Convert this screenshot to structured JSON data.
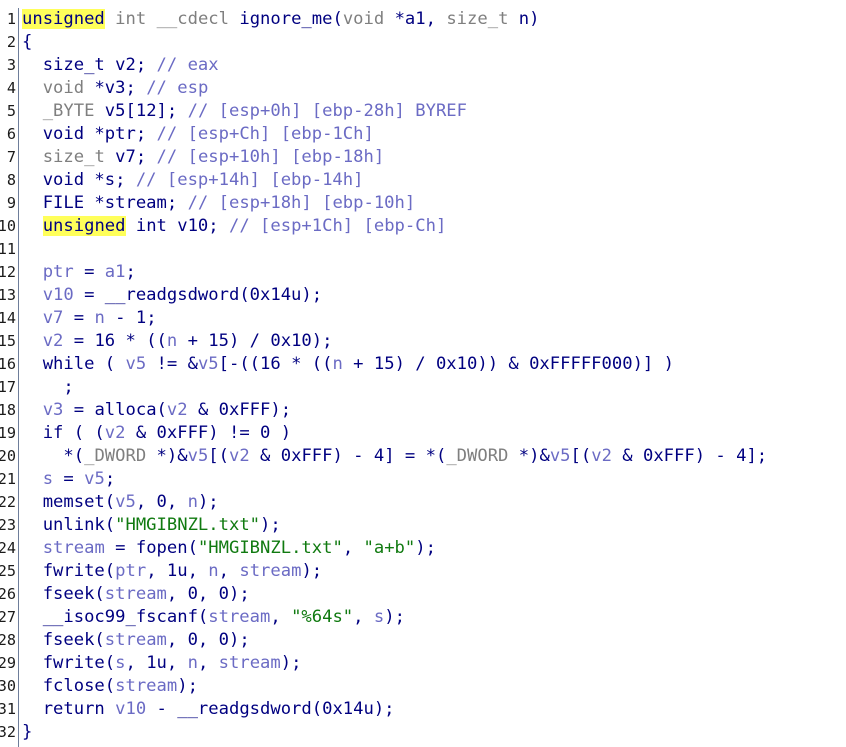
{
  "gutter": [
    "1",
    "2",
    "3",
    "4",
    "5",
    "6",
    "7",
    "8",
    "9",
    "10",
    "11",
    "12",
    "13",
    "14",
    "15",
    "16",
    "17",
    "18",
    "19",
    "20",
    "21",
    "22",
    "23",
    "24",
    "25",
    "26",
    "27",
    "28",
    "29",
    "30",
    "31",
    "32"
  ],
  "lines": [
    [
      [
        "hl",
        "unsigned"
      ],
      [
        "plain",
        " "
      ],
      [
        "type",
        "int"
      ],
      [
        "plain",
        " "
      ],
      [
        "type",
        "__cdecl"
      ],
      [
        "plain",
        " ignore_me("
      ],
      [
        "type",
        "void"
      ],
      [
        "plain",
        " *a1, "
      ],
      [
        "type",
        "size_t"
      ],
      [
        "plain",
        " n)"
      ]
    ],
    [
      [
        "plain",
        "{"
      ]
    ],
    [
      [
        "plain",
        "  size_t v2; "
      ],
      [
        "cmt",
        "// eax"
      ]
    ],
    [
      [
        "plain",
        "  "
      ],
      [
        "type",
        "void"
      ],
      [
        "plain",
        " *v3; "
      ],
      [
        "cmt",
        "// esp"
      ]
    ],
    [
      [
        "plain",
        "  "
      ],
      [
        "type",
        "_BYTE"
      ],
      [
        "plain",
        " v5[12]; "
      ],
      [
        "cmt",
        "// [esp+0h] [ebp-28h] BYREF"
      ]
    ],
    [
      [
        "plain",
        "  void *ptr; "
      ],
      [
        "cmt",
        "// [esp+Ch] [ebp-1Ch]"
      ]
    ],
    [
      [
        "plain",
        "  "
      ],
      [
        "type",
        "size_t"
      ],
      [
        "plain",
        " v7; "
      ],
      [
        "cmt",
        "// [esp+10h] [ebp-18h]"
      ]
    ],
    [
      [
        "plain",
        "  void *s; "
      ],
      [
        "cmt",
        "// [esp+14h] [ebp-14h]"
      ]
    ],
    [
      [
        "plain",
        "  FILE *stream; "
      ],
      [
        "cmt",
        "// [esp+18h] [ebp-10h]"
      ]
    ],
    [
      [
        "plain",
        "  "
      ],
      [
        "hl",
        "unsigned"
      ],
      [
        "plain",
        " int v10; "
      ],
      [
        "cmt",
        "// [esp+1Ch] [ebp-Ch]"
      ]
    ],
    [
      [
        "plain",
        ""
      ]
    ],
    [
      [
        "plain",
        "  "
      ],
      [
        "var",
        "ptr"
      ],
      [
        "plain",
        " = "
      ],
      [
        "var",
        "a1"
      ],
      [
        "plain",
        ";"
      ]
    ],
    [
      [
        "plain",
        "  "
      ],
      [
        "var",
        "v10"
      ],
      [
        "plain",
        " = __readgsdword(0x14u);"
      ]
    ],
    [
      [
        "plain",
        "  "
      ],
      [
        "var",
        "v7"
      ],
      [
        "plain",
        " = "
      ],
      [
        "var",
        "n"
      ],
      [
        "plain",
        " - 1;"
      ]
    ],
    [
      [
        "plain",
        "  "
      ],
      [
        "var",
        "v2"
      ],
      [
        "plain",
        " = 16 * (("
      ],
      [
        "var",
        "n"
      ],
      [
        "plain",
        " + 15) / 0x10);"
      ]
    ],
    [
      [
        "plain",
        "  while ( "
      ],
      [
        "var",
        "v5"
      ],
      [
        "plain",
        " != &"
      ],
      [
        "var",
        "v5"
      ],
      [
        "plain",
        "[-((16 * (("
      ],
      [
        "var",
        "n"
      ],
      [
        "plain",
        " + 15) / 0x10)) & 0xFFFFF000)] )"
      ]
    ],
    [
      [
        "plain",
        "    ;"
      ]
    ],
    [
      [
        "plain",
        "  "
      ],
      [
        "var",
        "v3"
      ],
      [
        "plain",
        " = alloca("
      ],
      [
        "var",
        "v2"
      ],
      [
        "plain",
        " & 0xFFF);"
      ]
    ],
    [
      [
        "plain",
        "  if ( ("
      ],
      [
        "var",
        "v2"
      ],
      [
        "plain",
        " & 0xFFF) != 0 )"
      ]
    ],
    [
      [
        "plain",
        "    *("
      ],
      [
        "type",
        "_DWORD"
      ],
      [
        "plain",
        " *)&"
      ],
      [
        "var",
        "v5"
      ],
      [
        "plain",
        "[("
      ],
      [
        "var",
        "v2"
      ],
      [
        "plain",
        " & 0xFFF) - 4] = *("
      ],
      [
        "type",
        "_DWORD"
      ],
      [
        "plain",
        " *)&"
      ],
      [
        "var",
        "v5"
      ],
      [
        "plain",
        "[("
      ],
      [
        "var",
        "v2"
      ],
      [
        "plain",
        " & 0xFFF) - 4];"
      ]
    ],
    [
      [
        "plain",
        "  "
      ],
      [
        "var",
        "s"
      ],
      [
        "plain",
        " = "
      ],
      [
        "var",
        "v5"
      ],
      [
        "plain",
        ";"
      ]
    ],
    [
      [
        "plain",
        "  memset("
      ],
      [
        "var",
        "v5"
      ],
      [
        "plain",
        ", 0, "
      ],
      [
        "var",
        "n"
      ],
      [
        "plain",
        ");"
      ]
    ],
    [
      [
        "plain",
        "  unlink("
      ],
      [
        "str",
        "\"HMGIBNZL.txt\""
      ],
      [
        "plain",
        ");"
      ]
    ],
    [
      [
        "plain",
        "  "
      ],
      [
        "var",
        "stream"
      ],
      [
        "plain",
        " = fopen("
      ],
      [
        "str",
        "\"HMGIBNZL.txt\""
      ],
      [
        "plain",
        ", "
      ],
      [
        "str",
        "\"a+b\""
      ],
      [
        "plain",
        ");"
      ]
    ],
    [
      [
        "plain",
        "  fwrite("
      ],
      [
        "var",
        "ptr"
      ],
      [
        "plain",
        ", 1u, "
      ],
      [
        "var",
        "n"
      ],
      [
        "plain",
        ", "
      ],
      [
        "var",
        "stream"
      ],
      [
        "plain",
        ");"
      ]
    ],
    [
      [
        "plain",
        "  fseek("
      ],
      [
        "var",
        "stream"
      ],
      [
        "plain",
        ", 0, 0);"
      ]
    ],
    [
      [
        "plain",
        "  __isoc99_fscanf("
      ],
      [
        "var",
        "stream"
      ],
      [
        "plain",
        ", "
      ],
      [
        "str",
        "\"%64s\""
      ],
      [
        "plain",
        ", "
      ],
      [
        "var",
        "s"
      ],
      [
        "plain",
        ");"
      ]
    ],
    [
      [
        "plain",
        "  fseek("
      ],
      [
        "var",
        "stream"
      ],
      [
        "plain",
        ", 0, 0);"
      ]
    ],
    [
      [
        "plain",
        "  fwrite("
      ],
      [
        "var",
        "s"
      ],
      [
        "plain",
        ", 1u, "
      ],
      [
        "var",
        "n"
      ],
      [
        "plain",
        ", "
      ],
      [
        "var",
        "stream"
      ],
      [
        "plain",
        ");"
      ]
    ],
    [
      [
        "plain",
        "  fclose("
      ],
      [
        "var",
        "stream"
      ],
      [
        "plain",
        ");"
      ]
    ],
    [
      [
        "plain",
        "  return "
      ],
      [
        "var",
        "v10"
      ],
      [
        "plain",
        " - __readgsdword(0x14u);"
      ]
    ],
    [
      [
        "plain",
        "}"
      ]
    ]
  ]
}
